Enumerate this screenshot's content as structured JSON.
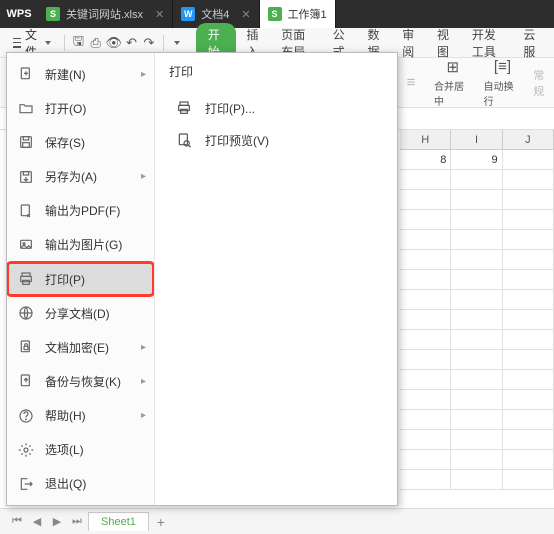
{
  "titlebar": {
    "logo": "WPS",
    "tabs": [
      {
        "label": "关键词网站.xlsx",
        "icon_color": "ic-green"
      },
      {
        "label": "文档4",
        "icon_color": "ic-blue"
      },
      {
        "label": "工作簿1",
        "icon_color": "ic-green",
        "active": true
      }
    ]
  },
  "menubar": {
    "file_label": "文件",
    "start_label": "开始",
    "tabs": [
      "插入",
      "页面布局",
      "公式",
      "数据",
      "审阅",
      "视图",
      "开发工具",
      "云服"
    ]
  },
  "ribbon": {
    "format_label": "常规",
    "merge_label": "合并居中",
    "wrap_label": "自动换行"
  },
  "file_menu": {
    "items": [
      {
        "id": "new",
        "label": "新建(N)",
        "icon": "new",
        "chev": true
      },
      {
        "id": "open",
        "label": "打开(O)",
        "icon": "open"
      },
      {
        "id": "save",
        "label": "保存(S)",
        "icon": "save"
      },
      {
        "id": "saveas",
        "label": "另存为(A)",
        "icon": "saveas",
        "chev": true
      },
      {
        "id": "pdf",
        "label": "输出为PDF(F)",
        "icon": "pdf"
      },
      {
        "id": "img",
        "label": "输出为图片(G)",
        "icon": "img"
      },
      {
        "id": "print",
        "label": "打印(P)",
        "icon": "print",
        "selected": true,
        "highlight": true
      },
      {
        "id": "share",
        "label": "分享文档(D)",
        "icon": "share"
      },
      {
        "id": "encrypt",
        "label": "文档加密(E)",
        "icon": "encrypt",
        "chev": true
      },
      {
        "id": "backup",
        "label": "备份与恢复(K)",
        "icon": "backup",
        "chev": true
      },
      {
        "id": "help",
        "label": "帮助(H)",
        "icon": "help",
        "chev": true
      },
      {
        "id": "options",
        "label": "选项(L)",
        "icon": "options"
      },
      {
        "id": "exit",
        "label": "退出(Q)",
        "icon": "exit"
      }
    ],
    "submenu": {
      "title": "打印",
      "items": [
        {
          "id": "print-dlg",
          "label": "打印(P)...",
          "icon": "print"
        },
        {
          "id": "preview",
          "label": "打印预览(V)",
          "icon": "preview"
        }
      ]
    }
  },
  "sheet": {
    "columns": [
      "H",
      "I",
      "J"
    ],
    "data_row": [
      "8",
      "9",
      ""
    ]
  },
  "sheet_tabs": {
    "active": "Sheet1"
  }
}
